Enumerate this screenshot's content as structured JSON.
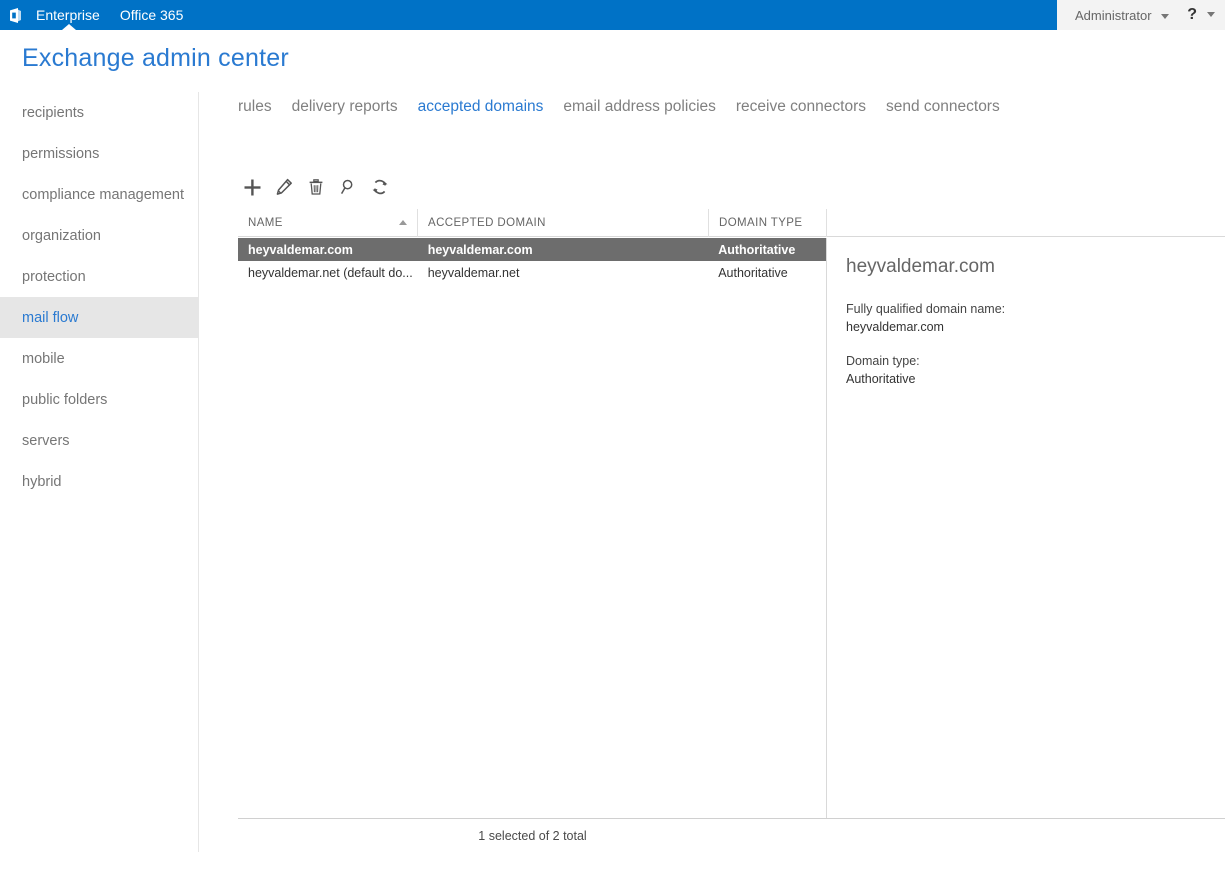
{
  "suite_bar": {
    "logo_icon": "office-logo-icon",
    "links": [
      {
        "label": "Enterprise",
        "active": true
      },
      {
        "label": "Office 365",
        "active": false
      }
    ],
    "user": "Administrator",
    "user_chevron_icon": "chevron-down-icon",
    "help_glyph": "?",
    "help_chevron_icon": "chevron-down-icon",
    "blue": "#0072c6"
  },
  "header": {
    "title": "Exchange admin center",
    "title_color": "#2a7ad1"
  },
  "sidebar": {
    "items": [
      {
        "label": "recipients",
        "selected": false
      },
      {
        "label": "permissions",
        "selected": false
      },
      {
        "label": "compliance management",
        "selected": false
      },
      {
        "label": "organization",
        "selected": false
      },
      {
        "label": "protection",
        "selected": false
      },
      {
        "label": "mail flow",
        "selected": true
      },
      {
        "label": "mobile",
        "selected": false
      },
      {
        "label": "public folders",
        "selected": false
      },
      {
        "label": "servers",
        "selected": false
      },
      {
        "label": "hybrid",
        "selected": false
      }
    ]
  },
  "tabs": [
    {
      "label": "rules",
      "active": false
    },
    {
      "label": "delivery reports",
      "active": false
    },
    {
      "label": "accepted domains",
      "active": true
    },
    {
      "label": "email address policies",
      "active": false
    },
    {
      "label": "receive connectors",
      "active": false
    },
    {
      "label": "send connectors",
      "active": false
    }
  ],
  "toolbar": [
    {
      "name": "add-icon",
      "title": "New"
    },
    {
      "name": "edit-pencil-icon",
      "title": "Edit"
    },
    {
      "name": "delete-trash-icon",
      "title": "Delete"
    },
    {
      "name": "search-magnifier-icon",
      "title": "Search"
    },
    {
      "name": "refresh-icon",
      "title": "Refresh"
    }
  ],
  "grid": {
    "columns": [
      {
        "label": "NAME",
        "sorted": "asc"
      },
      {
        "label": "ACCEPTED DOMAIN",
        "sorted": ""
      },
      {
        "label": "DOMAIN TYPE",
        "sorted": ""
      },
      {
        "label": "",
        "sorted": ""
      }
    ],
    "rows": [
      {
        "name": "heyvaldemar.com",
        "accepted_domain": "heyvaldemar.com",
        "domain_type": "Authoritative",
        "selected": true
      },
      {
        "name": "heyvaldemar.net (default do...",
        "accepted_domain": "heyvaldemar.net",
        "domain_type": "Authoritative",
        "selected": false
      }
    ]
  },
  "details": {
    "title": "heyvaldemar.com",
    "fqdn_label": "Fully qualified domain name:",
    "fqdn_value": "heyvaldemar.com",
    "domain_type_label": "Domain type:",
    "domain_type_value": "Authoritative"
  },
  "status": {
    "text": "1 selected of 2 total"
  }
}
